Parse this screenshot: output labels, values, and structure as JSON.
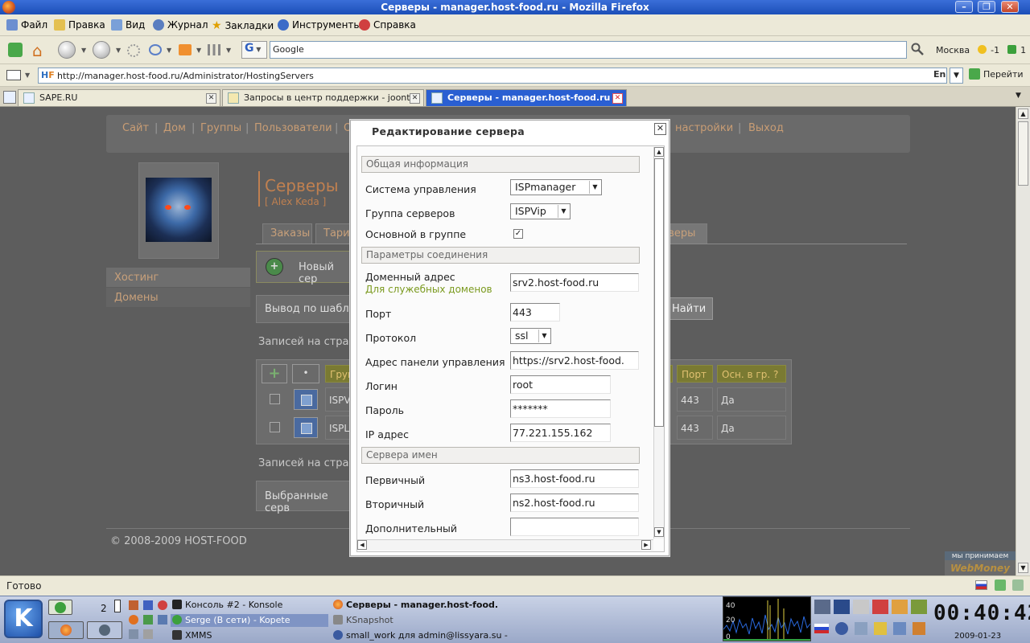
{
  "window": {
    "title": "Серверы - manager.host-food.ru - Mozilla Firefox"
  },
  "menubar": [
    {
      "label": "Файл",
      "icon": "file-icon"
    },
    {
      "label": "Правка",
      "icon": "edit-icon"
    },
    {
      "label": "Вид",
      "icon": "view-icon"
    },
    {
      "label": "Журнал",
      "icon": "history-icon"
    },
    {
      "label": "Закладки",
      "icon": "bookmark-star-icon"
    },
    {
      "label": "Инструменты",
      "icon": "tools-icon"
    },
    {
      "label": "Справка",
      "icon": "help-icon"
    }
  ],
  "search": {
    "engine": "G",
    "value": "Google"
  },
  "weather": {
    "city": "Москва",
    "temp": "-1",
    "extra": "1"
  },
  "url": "http://manager.host-food.ru/Administrator/HostingServers",
  "lang": "En",
  "go_label": "Перейти",
  "tabs": [
    {
      "label": "SAPE.RU"
    },
    {
      "label": "Запросы в центр поддержки - joont..."
    },
    {
      "label": "Серверы - manager.host-food.ru",
      "active": true
    }
  ],
  "site_nav": [
    "Сайт",
    "Дом",
    "Группы",
    "Пользователи",
    "О",
    "настройки",
    "Выход"
  ],
  "page": {
    "title": "Серверы",
    "subtitle": "[ Alex Keda ]",
    "side_menu": [
      "Хостинг",
      "Домены"
    ],
    "subtabs": [
      "Заказы",
      "Тари",
      "рверы"
    ],
    "new_server": "Новый сер",
    "output_by": "Вывод по шабло",
    "find": "Найти",
    "records_per_page": "Записей на стран",
    "table_headers": [
      "Груп",
      "Порт",
      "Осн. в гр. ?"
    ],
    "rows": [
      {
        "name": "ISPV",
        "port": "443",
        "main": "Да"
      },
      {
        "name": "ISPL",
        "port": "443",
        "main": "Да"
      }
    ],
    "records_per_page_2": "Записей на стран",
    "selected_servers": "Выбранные серв",
    "footer": "© 2008-2009 HOST-FOOD",
    "webmoney_caption": "мы принимаем",
    "webmoney_logo": "WebMoney"
  },
  "modal": {
    "title": "Редактирование сервера",
    "sections": {
      "general": "Общая информация",
      "connection": "Параметры соединения",
      "nameservers": "Сервера имен"
    },
    "fields": {
      "control_system": {
        "label": "Система управления",
        "value": "ISPmanager"
      },
      "server_group": {
        "label": "Группа серверов",
        "value": "ISPVip"
      },
      "main_in_group": {
        "label": "Основной в группе",
        "checked": "✓"
      },
      "domain": {
        "label": "Доменный адрес",
        "hint": "Для служебных доменов",
        "value": "srv2.host-food.ru"
      },
      "port": {
        "label": "Порт",
        "value": "443"
      },
      "protocol": {
        "label": "Протокол",
        "value": "ssl"
      },
      "panel_address": {
        "label": "Адрес панели управления",
        "value": "https://srv2.host-food."
      },
      "login": {
        "label": "Логин",
        "value": "root"
      },
      "password": {
        "label": "Пароль",
        "value": "*******"
      },
      "ip": {
        "label": "IP адрес",
        "value": "77.221.155.162"
      },
      "primary_ns": {
        "label": "Первичный",
        "value": "ns3.host-food.ru"
      },
      "secondary_ns": {
        "label": "Вторичный",
        "value": "ns2.host-food.ru"
      },
      "extra_ns": {
        "label": "Дополнительный",
        "value": ""
      }
    }
  },
  "status": "Готово",
  "taskbar": {
    "desktop_num": "2",
    "tasks": [
      {
        "label": "Консоль #2 - Konsole"
      },
      {
        "label": "Serge (В сети) - Kopete"
      },
      {
        "label": "XMMS"
      },
      {
        "label": "Серверы - manager.host-food."
      },
      {
        "label": "KSnapshot"
      },
      {
        "label": "small_work для admin@lissyara.su -"
      }
    ],
    "graph_ticks": [
      "40",
      "20",
      "0"
    ],
    "clock": "00:40:42",
    "date": "2009-01-23"
  }
}
